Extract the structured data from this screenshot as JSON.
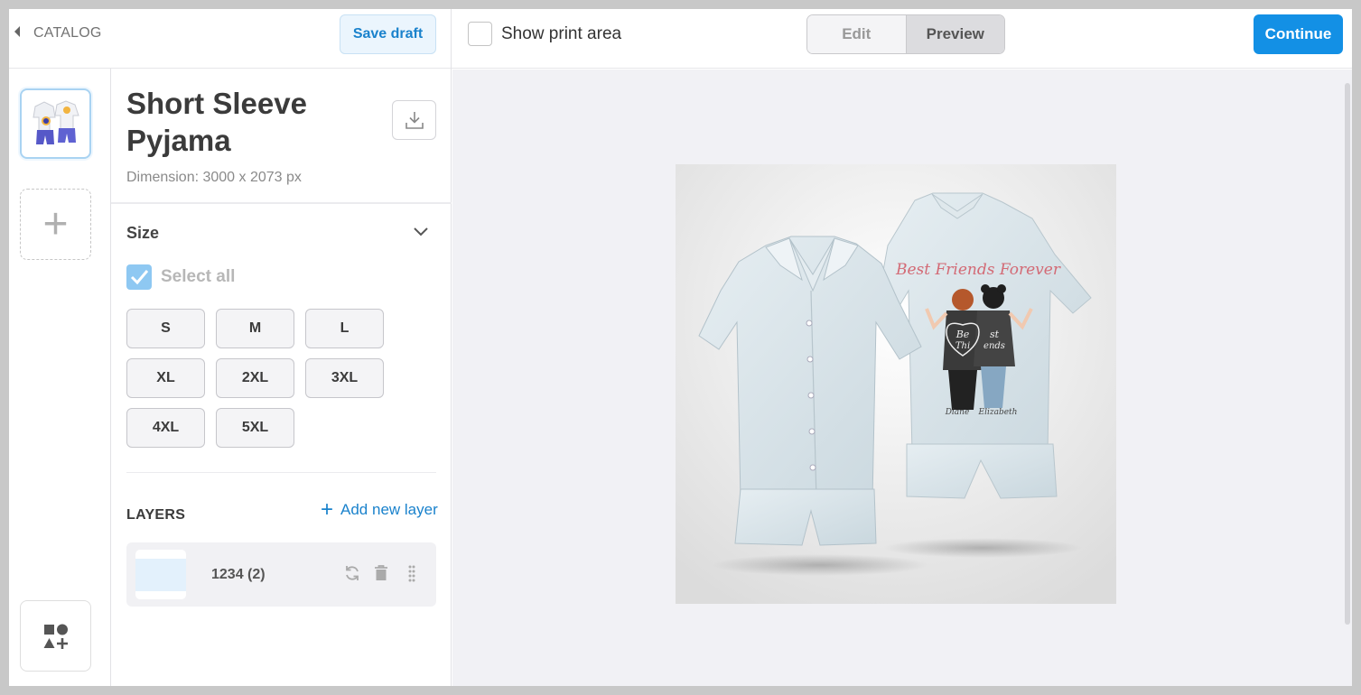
{
  "header": {
    "back_label": "CATALOG",
    "save_draft": "Save draft",
    "show_print_area": "Show print area",
    "mode_edit": "Edit",
    "mode_preview": "Preview",
    "active_mode": "Preview",
    "continue": "Continue"
  },
  "product": {
    "title": "Short Sleeve Pyjama",
    "dimension": "Dimension: 3000 x 2073 px"
  },
  "size": {
    "heading": "Size",
    "select_all": "Select all",
    "select_all_checked": true,
    "options": [
      "S",
      "M",
      "L",
      "XL",
      "2XL",
      "3XL",
      "4XL",
      "5XL"
    ]
  },
  "layers": {
    "heading": "LAYERS",
    "add_label": "Add new layer",
    "items": [
      {
        "name": "1234 (2)"
      }
    ]
  },
  "preview": {
    "print_text": "Best Friends Forever",
    "names": [
      "Diane",
      "Elizabeth"
    ],
    "jacket_text": [
      "Be",
      "Thi",
      "st",
      "ends"
    ]
  },
  "colors": {
    "accent": "#1390e5",
    "fabric": "#d6e2e8",
    "canvas_bg": "#f1f1f5"
  }
}
